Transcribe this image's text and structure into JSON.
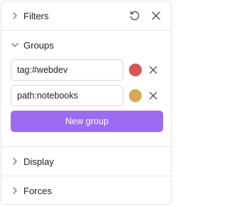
{
  "colors": {
    "accent": "#9b6cf2",
    "group_colors": [
      "#d65656",
      "#d9a853"
    ],
    "icon": "#555555"
  },
  "filters": {
    "title": "Filters",
    "reset_icon": "reset-icon",
    "close_icon": "close-icon",
    "expanded": false
  },
  "groups": {
    "title": "Groups",
    "expanded": true,
    "items": [
      {
        "query": "tag:#webdev",
        "color": "#d65656"
      },
      {
        "query": "path:notebooks",
        "color": "#d9a853"
      }
    ],
    "new_group_label": "New group"
  },
  "display": {
    "title": "Display",
    "expanded": false
  },
  "forces": {
    "title": "Forces",
    "expanded": false
  }
}
